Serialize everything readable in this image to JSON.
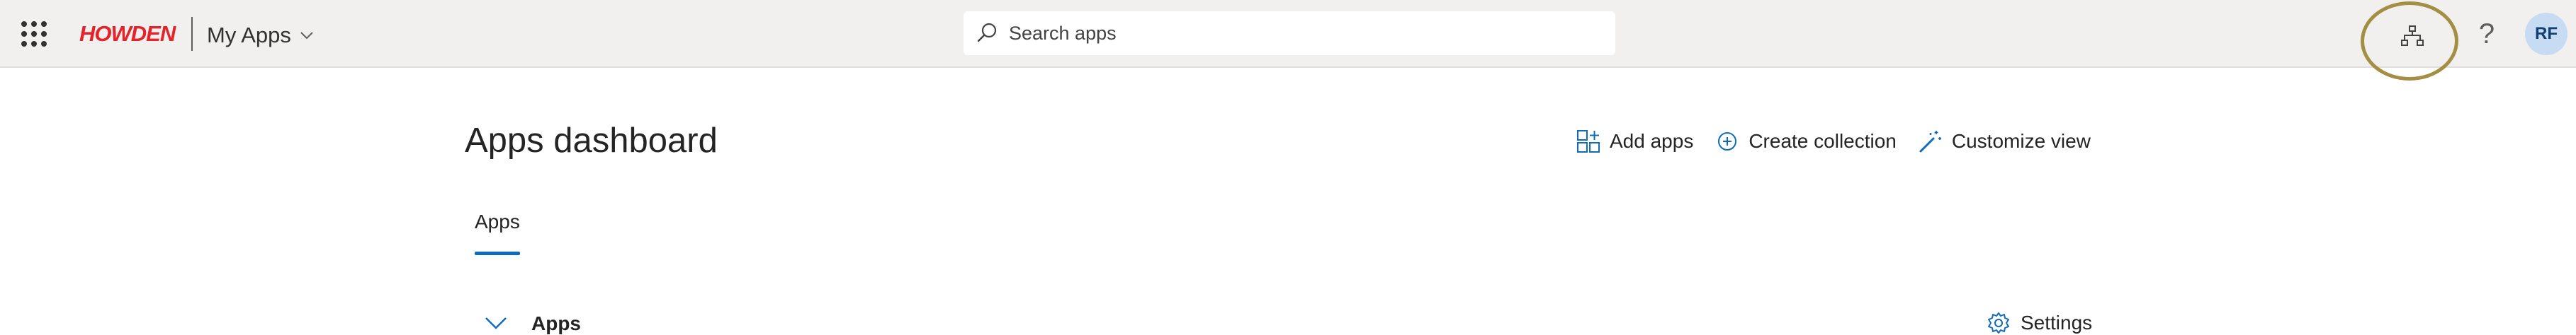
{
  "header": {
    "logo_text": "HOWDEN",
    "app_title": "My Apps",
    "search_placeholder": "Search apps",
    "help_label": "?",
    "avatar_initials": "RF",
    "accent_color": "#0f6cbd",
    "logo_color": "#e4242b",
    "highlight_color": "#a48e43"
  },
  "main": {
    "title": "Apps dashboard",
    "actions": [
      {
        "label": "Add apps",
        "icon": "add-apps-icon"
      },
      {
        "label": "Create collection",
        "icon": "add-circle-icon"
      },
      {
        "label": "Customize view",
        "icon": "magic-wand-icon"
      }
    ],
    "tabs": [
      {
        "label": "Apps",
        "selected": true
      }
    ],
    "section": {
      "title": "Apps",
      "settings_label": "Settings"
    }
  }
}
